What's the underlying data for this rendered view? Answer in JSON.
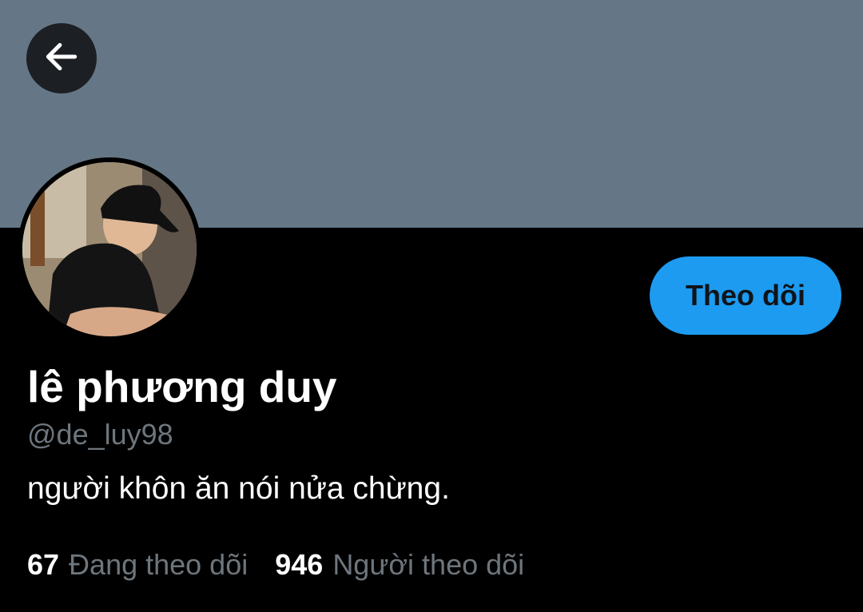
{
  "header": {
    "back_icon": "arrow-left-icon",
    "banner_color": "#657786"
  },
  "profile": {
    "display_name": "lê phương duy",
    "handle": "@de_luy98",
    "bio": "người khôn ăn nói nửa chừng.",
    "follow_label": "Theo dõi",
    "accent_color": "#1d9bf0"
  },
  "stats": {
    "following_count": "67",
    "following_label": "Đang theo dõi",
    "followers_count": "946",
    "followers_label": "Người theo dõi"
  }
}
